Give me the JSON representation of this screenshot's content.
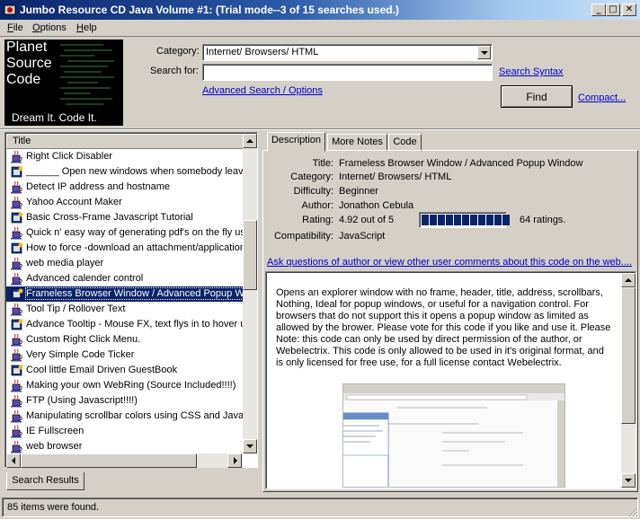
{
  "window": {
    "title": "Jumbo Resource CD Java Volume #1: (Trial mode--3 of 15 searches used.)",
    "min": "_",
    "max": "□",
    "close": "✕"
  },
  "menu": {
    "file_first": "F",
    "file_rest": "ile",
    "options_first": "O",
    "options_rest": "ptions",
    "help_first": "H",
    "help_rest": "elp"
  },
  "logo": {
    "line1": "Planet",
    "line2": "Source",
    "line3": "Code",
    "tagline": "Dream It.  Code It."
  },
  "search": {
    "category_label": "Category:",
    "category_value": "Internet/ Browsers/ HTML",
    "searchfor_label": "Search for:",
    "searchfor_value": "",
    "search_syntax": "Search Syntax",
    "advanced": "Advanced Search / Options",
    "find": "Find",
    "compact": "Compact..."
  },
  "list": {
    "header": "Title",
    "items": [
      "Right Click Disabler",
      "______ Open new windows when somebody leave",
      "Detect IP address and hostname",
      "Yahoo Account Maker",
      "Basic Cross-Frame Javascript Tutorial",
      "Quick n' easy way of generating pdf's on the fly usi",
      "How to force -download an attachment/application",
      "web media player",
      "Advanced calender control",
      "Frameless Browser Window / Advanced Popup W",
      "Tool Tip / Rollover Text",
      "Advance Tooltip - Mouse FX, text flys in to hover u",
      "Custom Right Click Menu.",
      "Very Simple Code Ticker",
      "Cool little Email Driven GuestBook",
      "Making your own WebRing (Source Included!!!!)",
      "FTP (Using Javascript!!!!)",
      "Manipulating scrollbar colors using CSS and JavaS",
      "IE Fullscreen",
      "web browser"
    ],
    "selected_index": 9,
    "tab": "Search Results"
  },
  "status": {
    "text": "85 items were found."
  },
  "tabs": {
    "description": "Description",
    "more_notes": "More Notes",
    "code": "Code"
  },
  "details": {
    "title_label": "Title:",
    "title": "Frameless Browser Window / Advanced Popup Window",
    "category_label": "Category:",
    "category": "Internet/ Browsers/ HTML",
    "difficulty_label": "Difficulty:",
    "difficulty": "Beginner",
    "author_label": "Author:",
    "author": "Jonathon Cebula",
    "rating_label": "Rating:",
    "rating": "4.92 out of 5",
    "rating_fraction": 0.984,
    "ratings_count": "64 ratings.",
    "compat_label": "Compatibility:",
    "compat": "JavaScript",
    "ask_link": "Ask questions of author or view other user comments about this code on the web...."
  },
  "description_text": "Opens an explorer window with no frame, header, title, address, scrollbars, Nothing, Ideal for popup windows, or useful for a navigation control. For browsers that do not support this it opens a popup window as limited as allowed by the brower. Please vote for this code if you like and use it. Please Note: this code can only be used by direct permission of the author, or Webelectrix. This code is only allowed to be used in it's original format, and is only licensed for free use, for a full license contact Webelectrix.",
  "colors": {
    "face": "#d4d0c8",
    "selection": "#0a246a",
    "link": "#0000cc"
  }
}
